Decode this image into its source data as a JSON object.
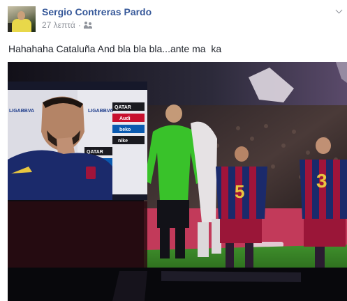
{
  "post": {
    "author": "Sergio Contreras Pardo",
    "time": "27 λεπτά",
    "separator": "·",
    "audience_icon": "friends-icon",
    "menu_icon": "chevron-down-icon",
    "text": "Hahahaha Cataluña And bla bla bla...ante ma  ka"
  },
  "photo": {
    "sponsor_board": [
      "LIGABBVA",
      "QATAR",
      "Audi",
      "beko",
      "nike",
      "LIGABBVA",
      "QATAR",
      "beko"
    ],
    "left_jersey_number": "5",
    "right_jersey_number": "3"
  },
  "colors": {
    "link": "#365899",
    "meta": "#90949c",
    "referee_shirt": "#39c22a",
    "barca_blue": "#1b2a6b",
    "barca_red": "#a0143a"
  }
}
